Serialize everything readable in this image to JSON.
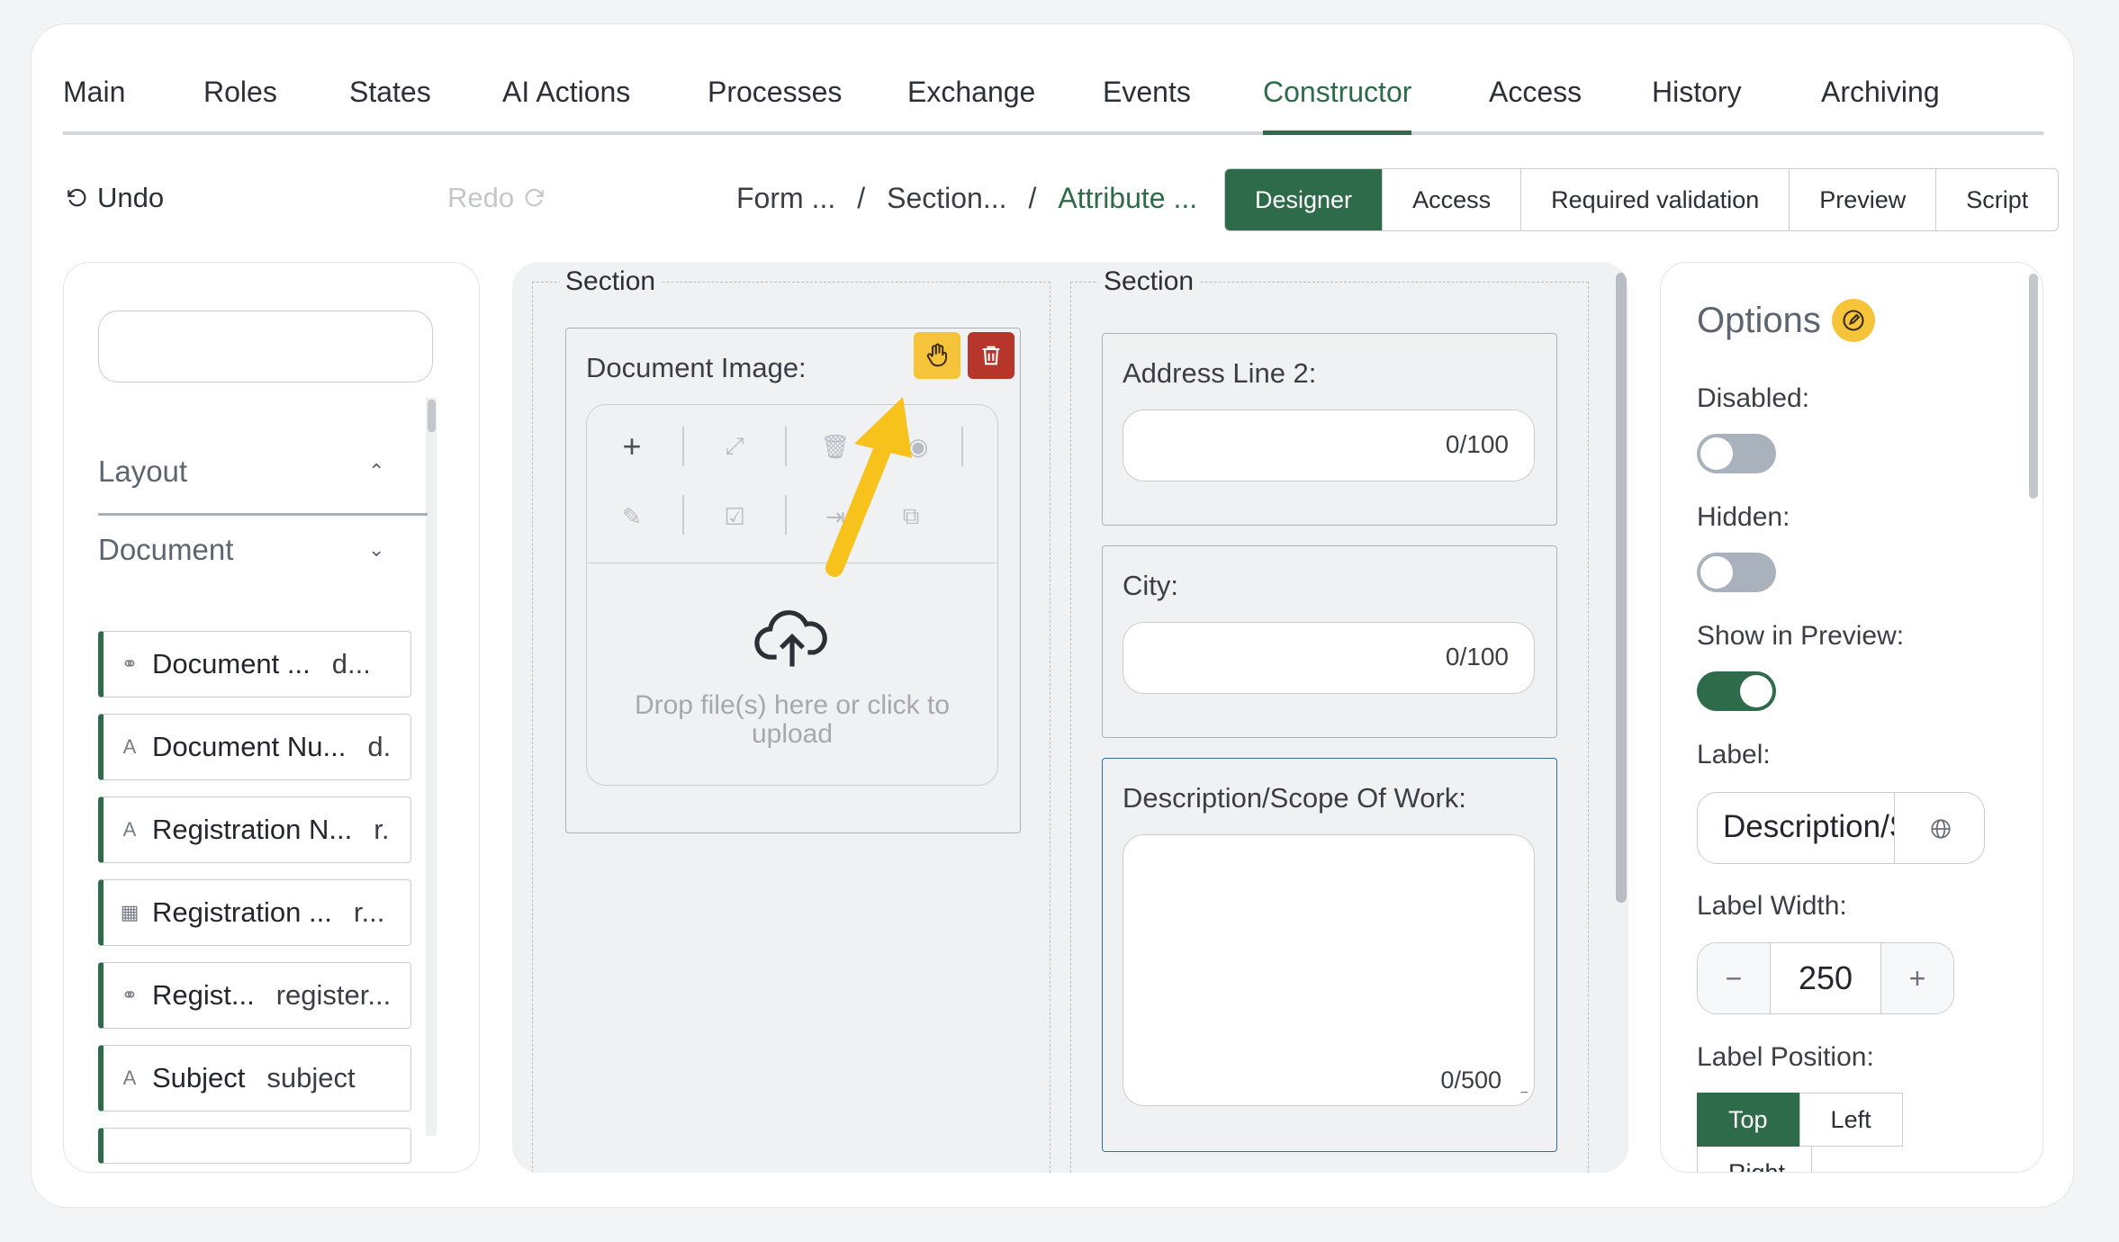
{
  "tabs": [
    "Main",
    "Roles",
    "States",
    "AI Actions",
    "Processes",
    "Exchange",
    "Events",
    "Constructor",
    "Access",
    "History",
    "Archiving"
  ],
  "active_tab": "Constructor",
  "toolbar": {
    "undo": "Undo",
    "redo": "Redo",
    "breadcrumb": [
      "Form ...",
      "Section...",
      "Attribute ..."
    ],
    "breadcrumb_sep": "/",
    "modes": [
      "Designer",
      "Access",
      "Required validation",
      "Preview",
      "Script"
    ],
    "active_mode": "Designer"
  },
  "palette": {
    "search_placeholder": "",
    "groups": [
      {
        "label": "Layout",
        "state": "expanded"
      },
      {
        "label": "Document",
        "state": "collapsed"
      }
    ],
    "items": [
      {
        "icon": "link-icon",
        "name": "Document ...",
        "key": "d..."
      },
      {
        "icon": "text-icon",
        "name": "Document Nu...",
        "key": "d."
      },
      {
        "icon": "text-icon",
        "name": "Registration N...",
        "key": "r."
      },
      {
        "icon": "calendar-icon",
        "name": "Registration ...",
        "key": "r..."
      },
      {
        "icon": "link-icon",
        "name": "Regist...",
        "key": "register..."
      },
      {
        "icon": "text-icon",
        "name": "Subject",
        "key": "subject"
      }
    ]
  },
  "canvas": {
    "sections": [
      {
        "title": "Section",
        "fields": [
          {
            "label": "Document Image:",
            "type": "file",
            "drop_text": "Drop file(s) here or click to upload"
          }
        ]
      },
      {
        "title": "Section",
        "fields": [
          {
            "label": "Address Line 2:",
            "type": "input",
            "counter": "0/100"
          },
          {
            "label": "City:",
            "type": "input",
            "counter": "0/100"
          },
          {
            "label": "Description/Scope Of Work:",
            "type": "textarea",
            "counter": "0/500"
          }
        ]
      }
    ]
  },
  "options": {
    "title": "Options",
    "disabled_label": "Disabled:",
    "disabled": false,
    "hidden_label": "Hidden:",
    "hidden": false,
    "show_preview_label": "Show in Preview:",
    "show_preview": true,
    "label_label": "Label:",
    "label_value": "Description/Scope Of Work",
    "label_width_label": "Label Width:",
    "label_width": "250",
    "label_position_label": "Label Position:",
    "positions": [
      "Top",
      "Left",
      "Right"
    ],
    "active_position": "Top"
  },
  "colors": {
    "accent": "#2e6b4a",
    "drag_handle": "#f6c43a",
    "delete": "#c0392b",
    "annotation_arrow": "#f7c21b"
  }
}
